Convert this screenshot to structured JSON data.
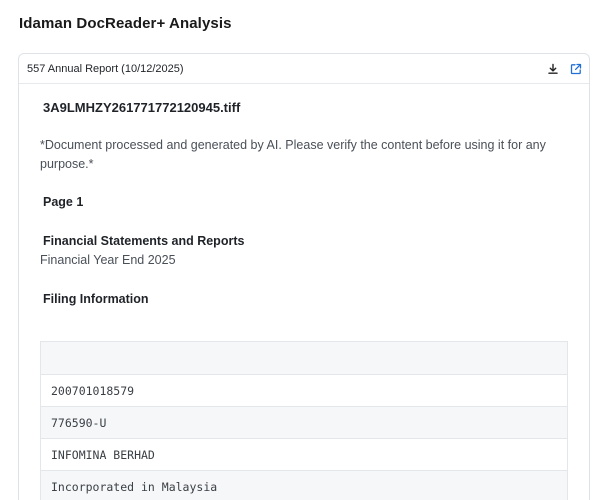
{
  "page": {
    "title": "Idaman DocReader+ Analysis"
  },
  "panel": {
    "title": "557 Annual Report (10/12/2025)",
    "actions": [
      {
        "icon": "download-icon"
      },
      {
        "icon": "external-link-icon"
      }
    ]
  },
  "document": {
    "file_name": "3A9LMHZY261771772120945.tiff",
    "disclaimer": "*Document processed and generated by AI. Please verify the content before using it for any purpose.*",
    "page_label": "Page 1",
    "section1_heading": "Financial Statements and Reports",
    "section1_text": "Financial Year End 2025",
    "section2_heading": "Filing Information",
    "table_header": "",
    "table_rows": [
      "200701018579",
      "776590-U",
      "INFOMINA BERHAD",
      "Incorporated in Malaysia"
    ]
  },
  "colors": {
    "accent": "#1f6fd6",
    "border": "#dfe3e8",
    "row_alt": "#f6f7f8"
  }
}
